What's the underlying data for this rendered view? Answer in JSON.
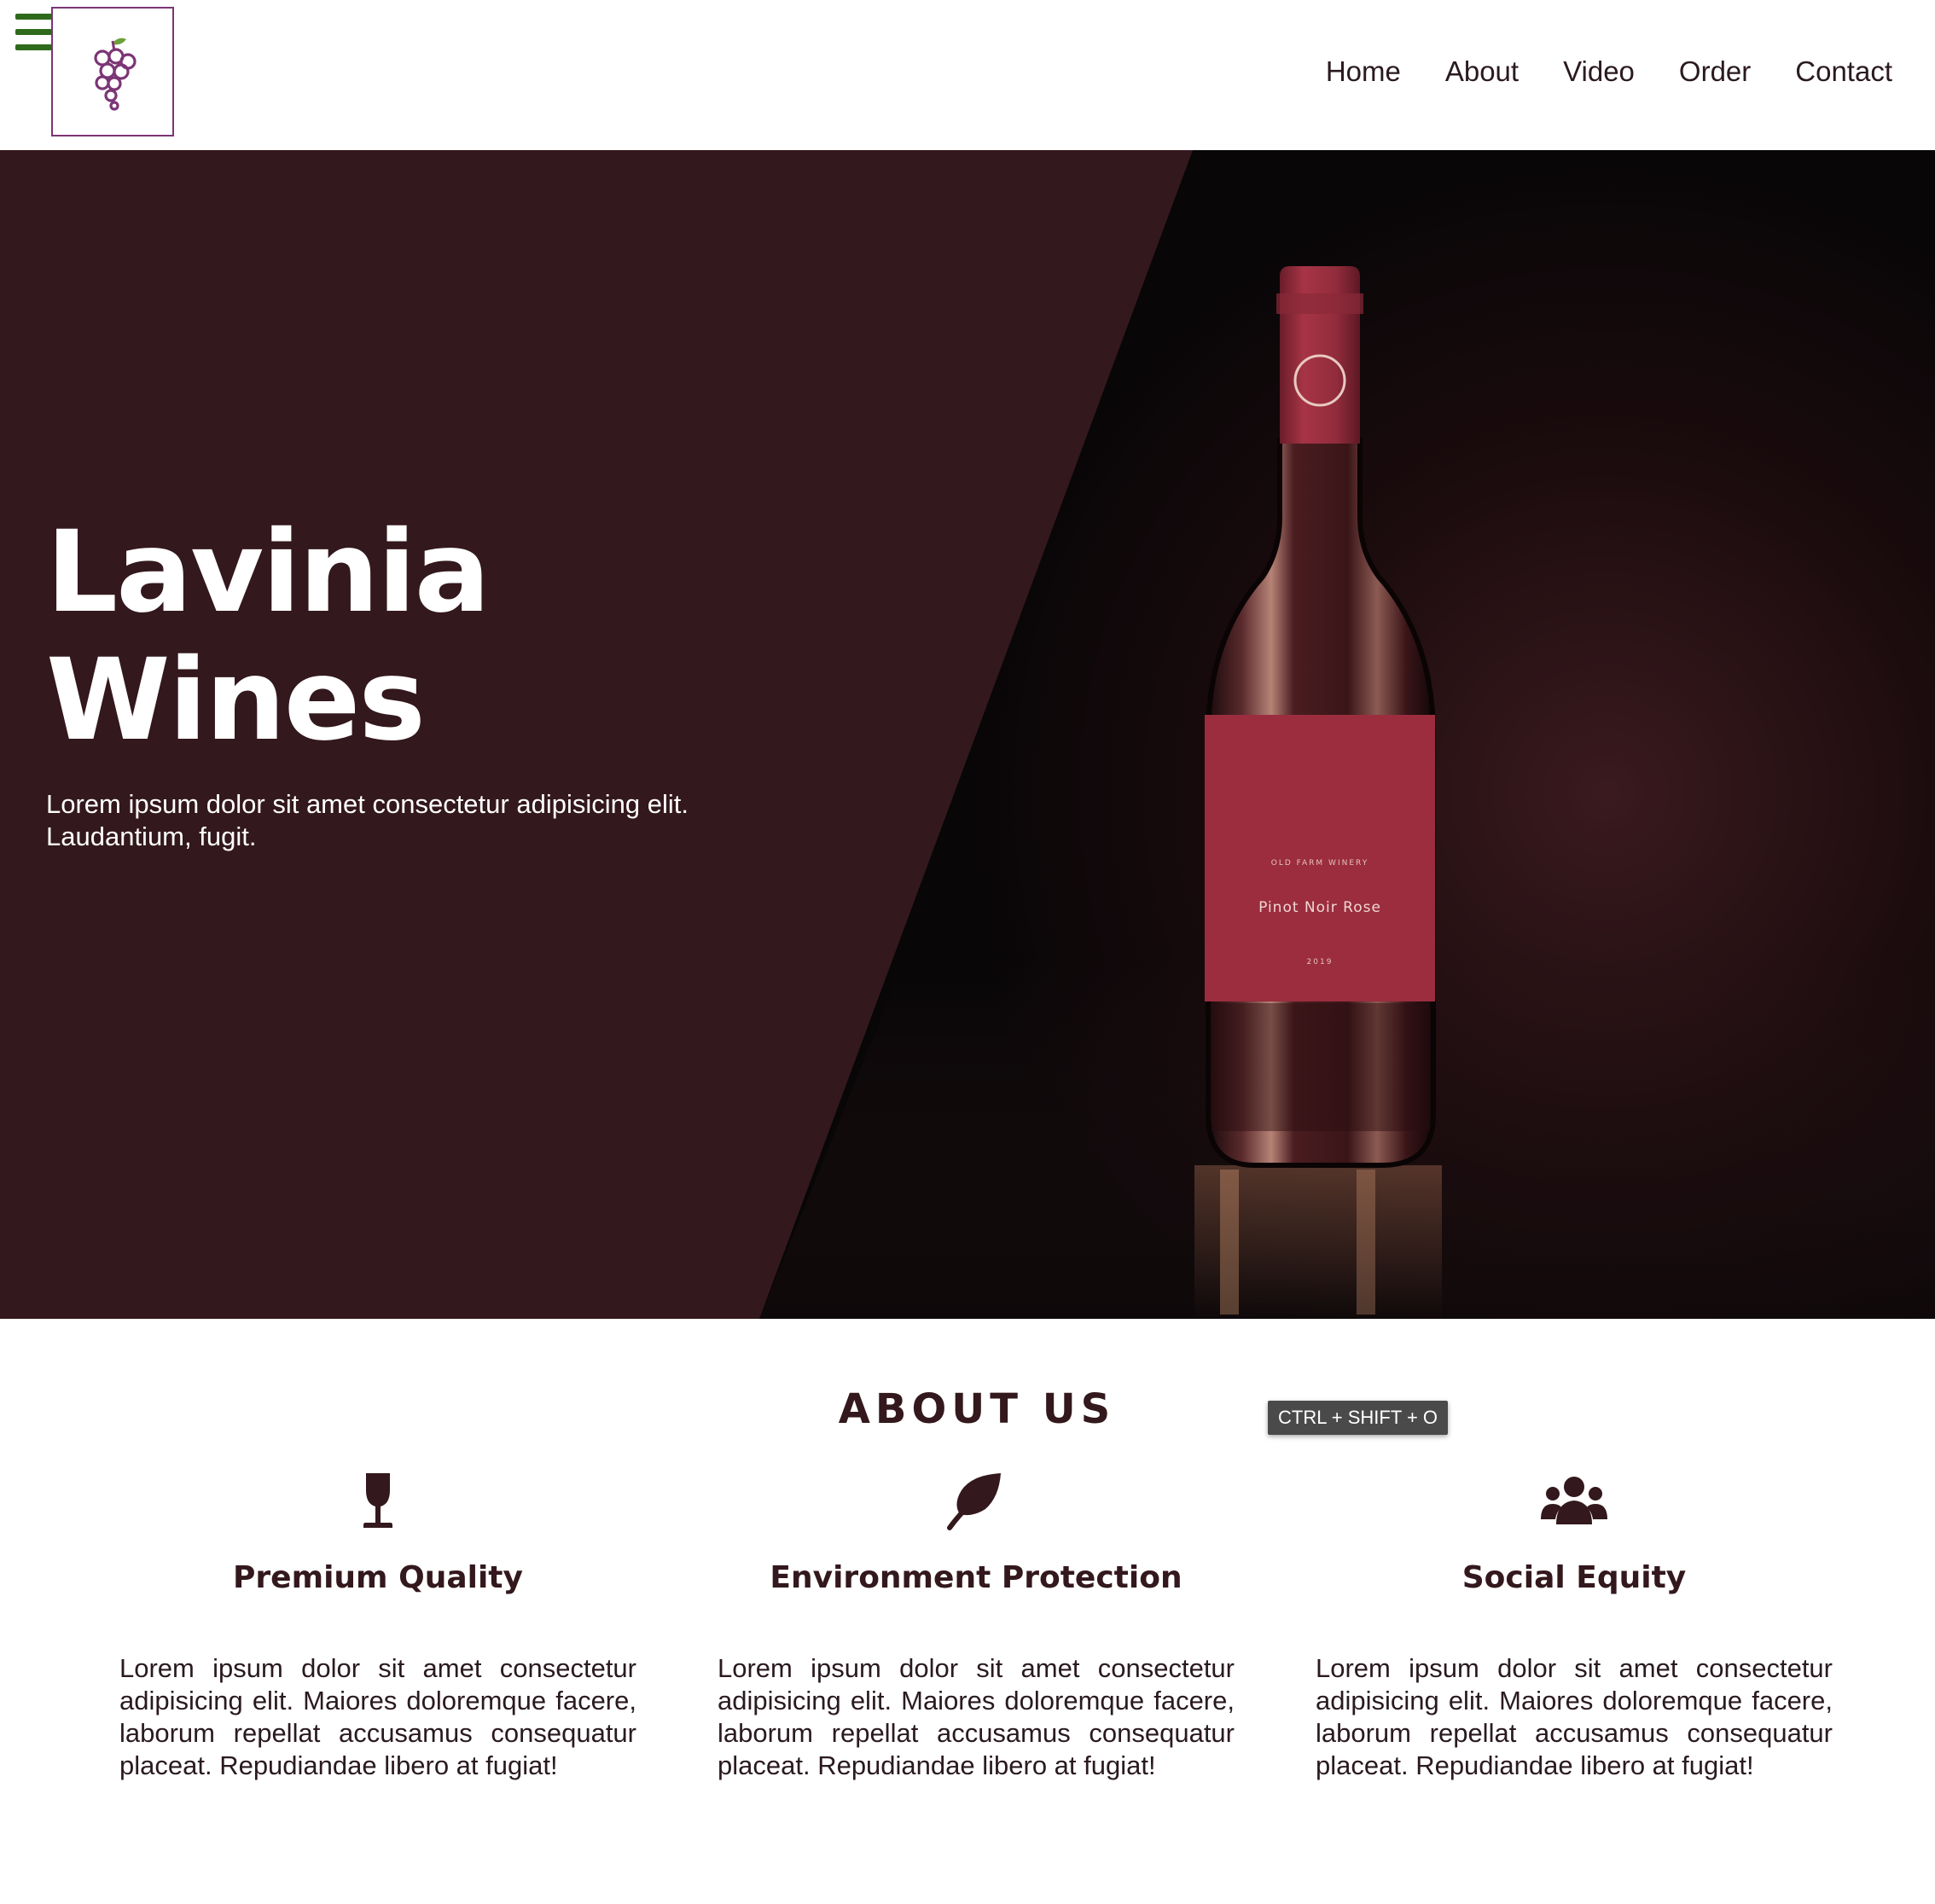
{
  "header": {
    "menu_icon": "hamburger-menu-icon",
    "logo_icon": "grapes-icon",
    "nav": [
      {
        "label": "Home"
      },
      {
        "label": "About"
      },
      {
        "label": "Video"
      },
      {
        "label": "Order"
      },
      {
        "label": "Contact"
      }
    ]
  },
  "hero": {
    "title": "Lavinia\nWines",
    "text": "Lorem ipsum dolor sit amet consectetur adipisicing elit. Laudantium, fugit.",
    "bottle_label": {
      "winery": "OLD FARM WINERY",
      "name": "Pinot Noir Rose",
      "year": "2019"
    }
  },
  "about": {
    "title": "ABOUT US",
    "shortcut_hint": "CTRL + SHIFT + O",
    "features": [
      {
        "icon": "wine-glass-icon",
        "title": "Premium Quality",
        "text": "Lorem ipsum dolor sit amet consectetur adipisicing elit. Maiores doloremque facere, laborum repellat accusamus consequatur placeat. Repudiandae libero at fugiat!"
      },
      {
        "icon": "leaf-icon",
        "title": "Environment Protection",
        "text": "Lorem ipsum dolor sit amet consectetur adipisicing elit. Maiores doloremque facere, laborum repellat accusamus consequatur placeat. Repudiandae libero at fugiat!"
      },
      {
        "icon": "people-group-icon",
        "title": "Social Equity",
        "text": "Lorem ipsum dolor sit amet consectetur adipisicing elit. Maiores doloremque facere, laborum repellat accusamus consequatur placeat. Repudiandae libero at fugiat!"
      }
    ]
  },
  "colors": {
    "brand_dark": "#33181d",
    "hero_dark": "#0a0a0a",
    "bottle_red": "#9b2d3f",
    "menu_green": "#2f6a1c",
    "logo_purple": "#7b3575"
  }
}
